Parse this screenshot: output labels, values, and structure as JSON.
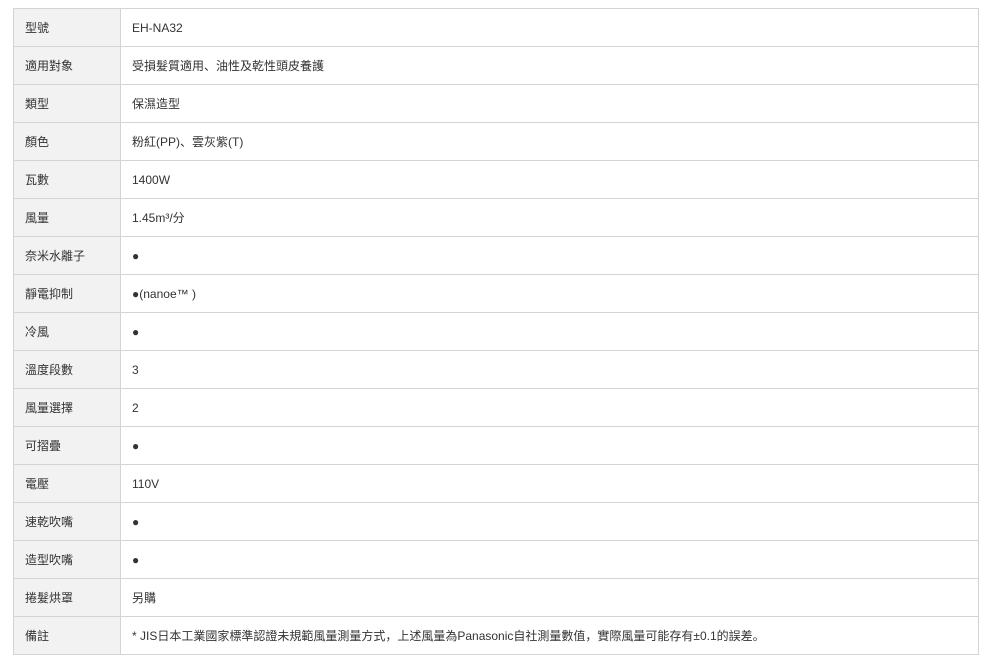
{
  "spec_table": {
    "rows": [
      {
        "label": "型號",
        "value": "EH-NA32"
      },
      {
        "label": "適用對象",
        "value": "受損髮質適用、油性及乾性頭皮養護"
      },
      {
        "label": "類型",
        "value": "保濕造型"
      },
      {
        "label": "顏色",
        "value": "粉紅(PP)、雲灰紫(T)"
      },
      {
        "label": "瓦數",
        "value": "1400W"
      },
      {
        "label": "風量",
        "value": "1.45m³/分"
      },
      {
        "label": "奈米水離子",
        "value": "●"
      },
      {
        "label": "靜電抑制",
        "value": "●(nanoe™ )"
      },
      {
        "label": "冷風",
        "value": "●"
      },
      {
        "label": "溫度段數",
        "value": "3"
      },
      {
        "label": "風量選擇",
        "value": "2"
      },
      {
        "label": "可摺疊",
        "value": "●"
      },
      {
        "label": "電壓",
        "value": "110V"
      },
      {
        "label": "速乾吹嘴",
        "value": "●"
      },
      {
        "label": "造型吹嘴",
        "value": "●"
      },
      {
        "label": "捲髮烘罩",
        "value": "另購"
      },
      {
        "label": "備註",
        "value": "* JIS日本工業國家標準認證未規範風量測量方式，上述風量為Panasonic自社測量數值，實際風量可能存有±0.1的誤差。"
      }
    ]
  }
}
